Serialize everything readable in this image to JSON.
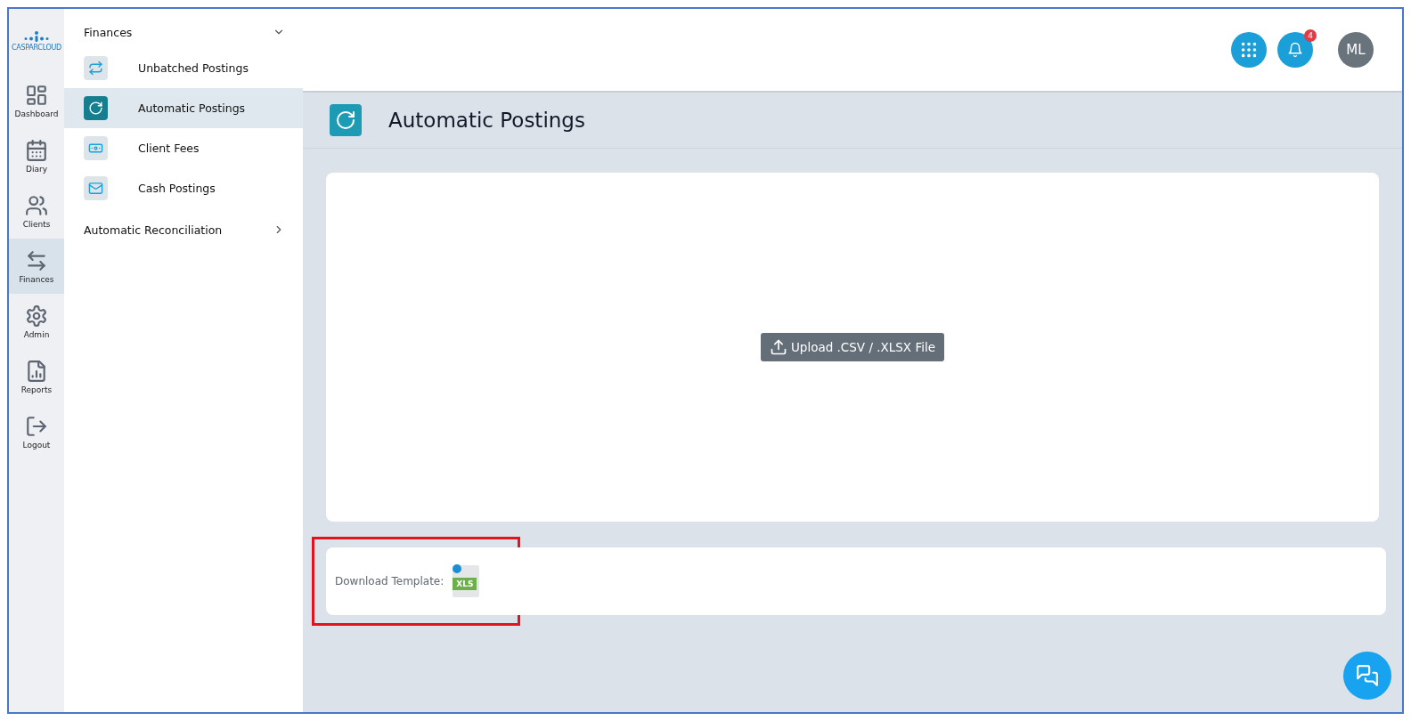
{
  "logo": {
    "text": "CASPARCLOUD"
  },
  "rail": [
    {
      "label": "Dashboard",
      "selected": false
    },
    {
      "label": "Diary",
      "selected": false
    },
    {
      "label": "Clients",
      "selected": false
    },
    {
      "label": "Finances",
      "selected": true
    },
    {
      "label": "Admin",
      "selected": false
    },
    {
      "label": "Reports",
      "selected": false
    },
    {
      "label": "Logout",
      "selected": false
    }
  ],
  "submenu": {
    "sections": [
      {
        "title": "Finances",
        "expanded": true,
        "items": [
          {
            "label": "Unbatched Postings",
            "selected": false
          },
          {
            "label": "Automatic Postings",
            "selected": true
          },
          {
            "label": "Client Fees",
            "selected": false
          },
          {
            "label": "Cash Postings",
            "selected": false
          }
        ]
      },
      {
        "title": "Automatic Reconciliation",
        "expanded": false
      }
    ]
  },
  "header": {
    "notification_count": "4",
    "avatar": "ML"
  },
  "page": {
    "title": "Automatic Postings",
    "upload_button": "Upload .CSV / .XLSX File",
    "download_label": "Download Template:",
    "file_badge": "XLS"
  }
}
